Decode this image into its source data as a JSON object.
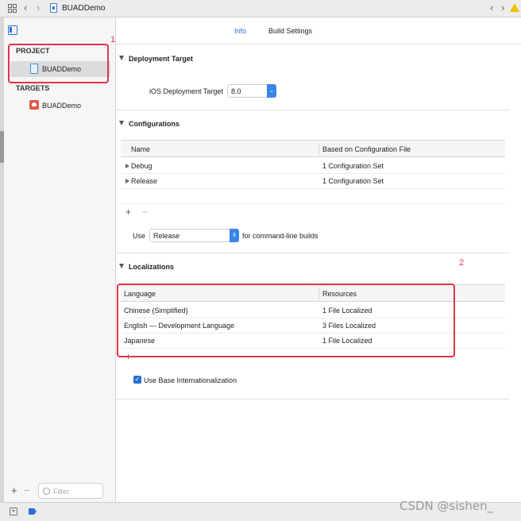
{
  "window": {
    "title": "BUADDemo",
    "warning_icon": "warning-triangle-icon"
  },
  "sidebar": {
    "sections": {
      "project_label": "PROJECT",
      "targets_label": "TARGETS"
    },
    "project_item": "BUADDemo",
    "target_item": "BUADDemo",
    "add_label": "+",
    "remove_label": "−",
    "filter_placeholder": "Filter"
  },
  "tabs": [
    {
      "label": "Info",
      "active": true
    },
    {
      "label": "Build Settings",
      "active": false
    }
  ],
  "deployment": {
    "header": "Deployment Target",
    "field_label": "iOS Deployment Target",
    "value": "8.0"
  },
  "configurations": {
    "header": "Configurations",
    "columns": [
      "Name",
      "Based on Configuration File"
    ],
    "rows": [
      {
        "name": "Debug",
        "file": "1 Configuration Set"
      },
      {
        "name": "Release",
        "file": "1 Configuration Set"
      }
    ],
    "add_label": "+",
    "remove_label": "−",
    "use_label": "Use",
    "use_value": "Release",
    "use_suffix": "for command-line builds"
  },
  "localizations": {
    "header": "Localizations",
    "columns": [
      "Language",
      "Resources"
    ],
    "rows": [
      {
        "language": "Chinese (Simplified)",
        "resources": "1 File Localized"
      },
      {
        "language": "English — Development Language",
        "resources": "3 Files Localized"
      },
      {
        "language": "Japanese",
        "resources": "1 File Localized"
      }
    ],
    "add_label": "+",
    "base_internationalization_label": "Use Base Internationalization",
    "base_internationalization_checked": true
  },
  "annotations": {
    "box1_number": "1",
    "box2_number": "2",
    "color": "#e0344a"
  },
  "watermark": "CSDN @sishen_",
  "colors": {
    "accent": "#2a6fd6",
    "annotation": "#e0344a",
    "warning": "#f0c000"
  }
}
